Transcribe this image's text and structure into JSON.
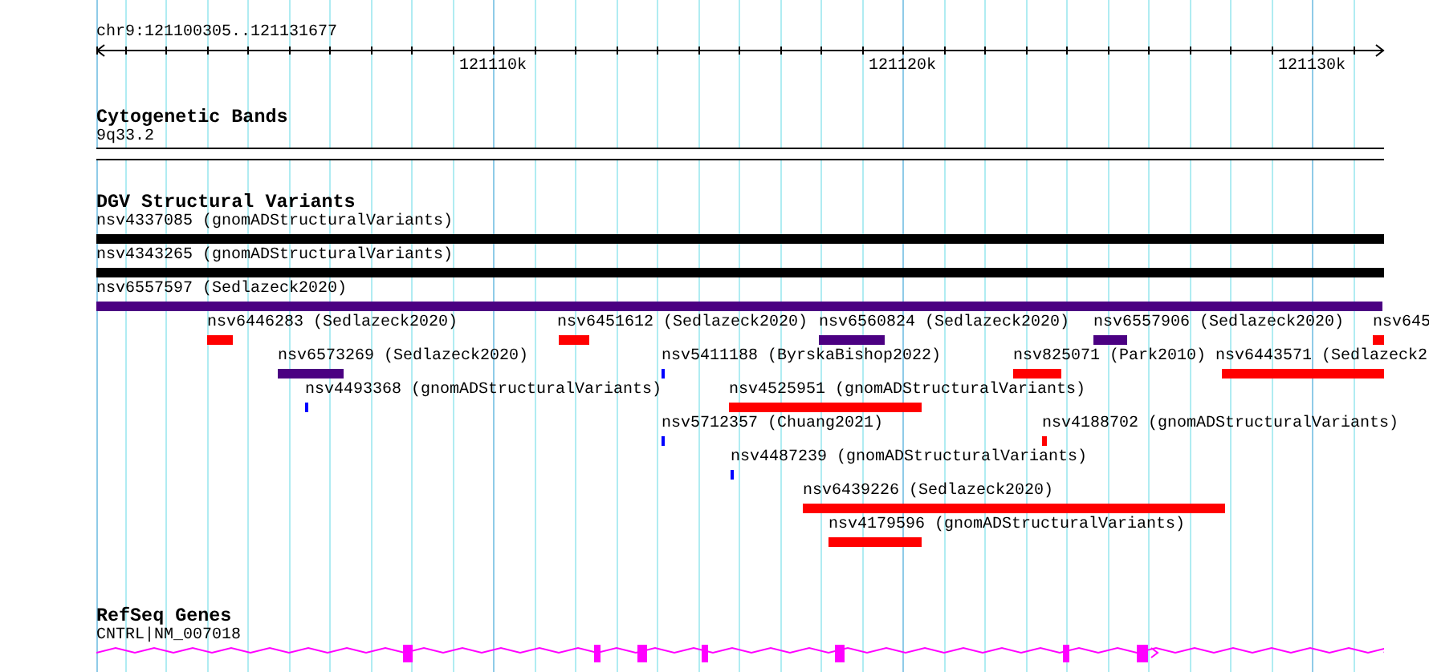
{
  "ruler": {
    "location": "chr9:121100305..121131677",
    "tick_labels": [
      "121110k",
      "121120k",
      "121130k"
    ]
  },
  "cytogenetic_bands": {
    "title": "Cytogenetic Bands",
    "band": "9q33.2"
  },
  "dgv_structural_variants": {
    "title": "DGV Structural Variants",
    "features": [
      {
        "label": "nsv4337085 (gnomADStructuralVariants)",
        "color": "#000000"
      },
      {
        "label": "nsv4343265 (gnomADStructuralVariants)",
        "color": "#000000"
      },
      {
        "label": "nsv6557597 (Sedlazeck2020)",
        "color": "#4b0082"
      },
      {
        "label": "nsv6446283 (Sedlazeck2020)",
        "color": "#ff0000"
      },
      {
        "label": "nsv6451612 (Sedlazeck2020)",
        "color": "#ff0000"
      },
      {
        "label": "nsv6560824 (Sedlazeck2020)",
        "color": "#4b0082"
      },
      {
        "label": "nsv6557906 (Sedlazeck2020)",
        "color": "#4b0082"
      },
      {
        "label": "nsv645",
        "color": "#ff0000"
      },
      {
        "label": "nsv6573269 (Sedlazeck2020)",
        "color": "#4b0082"
      },
      {
        "label": "nsv5411188 (ByrskaBishop2022)",
        "color": "#0000ff"
      },
      {
        "label": "nsv825071 (Park2010)",
        "color": "#ff0000"
      },
      {
        "label": "nsv6443571 (Sedlazeck2",
        "color": "#ff0000"
      },
      {
        "label": "nsv4493368 (gnomADStructuralVariants)",
        "color": "#0000ff"
      },
      {
        "label": "nsv4525951 (gnomADStructuralVariants)",
        "color": "#ff0000"
      },
      {
        "label": "nsv5712357 (Chuang2021)",
        "color": "#0000ff"
      },
      {
        "label": "nsv4188702 (gnomADStructuralVariants)",
        "color": "#ff0000"
      },
      {
        "label": "nsv4487239 (gnomADStructuralVariants)",
        "color": "#0000ff"
      },
      {
        "label": "nsv6439226 (Sedlazeck2020)",
        "color": "#ff0000"
      },
      {
        "label": "nsv4179596 (gnomADStructuralVariants)",
        "color": "#ff0000"
      }
    ]
  },
  "refseq_genes": {
    "title": "RefSeq Genes",
    "gene": "CNTRL|NM_007018"
  }
}
